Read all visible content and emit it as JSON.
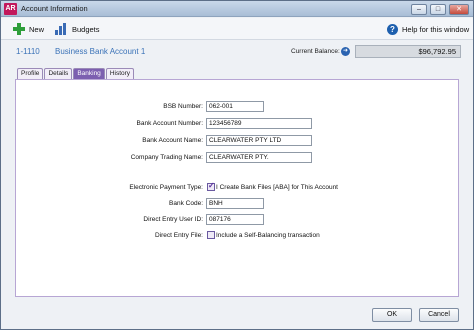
{
  "window": {
    "app_badge": "AR",
    "title": "Account Information",
    "minimize": "–",
    "maximize": "□",
    "close": "✕"
  },
  "toolbar": {
    "new_label": "New",
    "budgets_label": "Budgets",
    "help_label": "Help for this window"
  },
  "header": {
    "account_number": "1-1110",
    "account_name": "Business Bank Account 1",
    "balance_label": "Current Balance:",
    "balance_value": "$96,792.95"
  },
  "tabs": [
    {
      "label": "Profile",
      "active": false
    },
    {
      "label": "Details",
      "active": false
    },
    {
      "label": "Banking",
      "active": true
    },
    {
      "label": "History",
      "active": false
    }
  ],
  "banking": {
    "bsb_label": "BSB Number:",
    "bsb_value": "062-001",
    "acct_num_label": "Bank Account Number:",
    "acct_num_value": "123456789",
    "acct_name_label": "Bank Account Name:",
    "acct_name_value": "CLEARWATER PTY LTD",
    "trading_label": "Company Trading Name:",
    "trading_value": "CLEARWATER PTY.",
    "epay_label": "Electronic Payment Type:",
    "epay_checkbox_label": "I Create Bank Files [ABA] for This Account",
    "epay_checked": true,
    "bank_code_label": "Bank Code:",
    "bank_code_value": "BNH",
    "user_id_label": "Direct Entry User ID:",
    "user_id_value": "087176",
    "de_file_label": "Direct Entry File:",
    "de_file_checkbox_label": "Include a Self-Balancing transaction",
    "de_file_checked": false
  },
  "buttons": {
    "ok": "OK",
    "cancel": "Cancel"
  },
  "colors": {
    "tab_active": "#7c5fb0",
    "link_blue": "#3b73b8",
    "app_badge": "#c2185b"
  }
}
